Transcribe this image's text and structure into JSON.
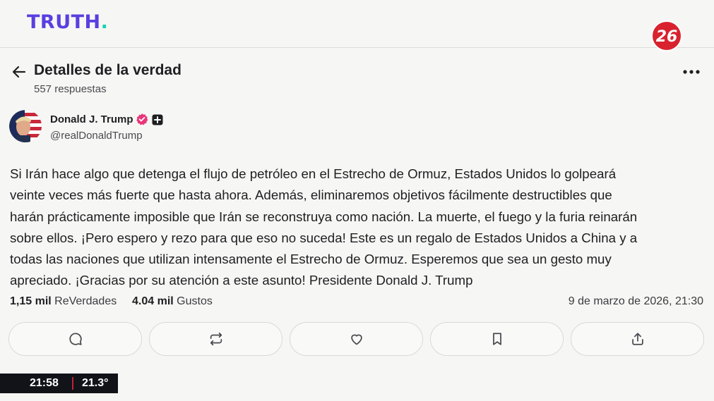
{
  "brand": {
    "logo_text": "TRUTH",
    "logo_dot": ".",
    "accent": "#5a3fe0",
    "dot_color": "#19d3b4"
  },
  "channel": {
    "badge_text": "26",
    "badge_color": "#d8232f"
  },
  "header": {
    "title": "Detalles de la verdad",
    "replies": "557 respuestas",
    "back_icon": "arrow-left-icon",
    "more_icon": "more-horizontal-icon"
  },
  "author": {
    "name": "Donald J. Trump",
    "handle": "@realDonaldTrump",
    "verified_color": "#e8367a"
  },
  "post": {
    "lines": [
      "Si Irán hace algo que detenga el flujo de petróleo en el Estrecho de Ormuz, Estados Unidos lo golpeará",
      "veinte veces más fuerte que hasta ahora. Además, eliminaremos objetivos fácilmente destructibles que",
      "harán prácticamente imposible que Irán se reconstruya como nación. La muerte, el fuego y la furia reinarán",
      "sobre ellos. ¡Pero espero y rezo para que eso no suceda! Este es un regalo de Estados Unidos a China y a",
      "todas las naciones que utilizan intensamente el Estrecho de Ormuz. Esperemos que sea un gesto muy",
      "apreciado. ¡Gracias por su atención a este asunto! Presidente Donald J. Trump"
    ]
  },
  "stats": {
    "retruths_count": "1,15 mil",
    "retruths_label": "ReVerdades",
    "likes_count": "4.04 mil",
    "likes_label": "Gustos",
    "timestamp": "9 de marzo de 2026, 21:30"
  },
  "actions": [
    {
      "icon": "reply-icon"
    },
    {
      "icon": "repost-icon"
    },
    {
      "icon": "heart-icon"
    },
    {
      "icon": "bookmark-icon"
    },
    {
      "icon": "share-icon"
    }
  ],
  "ticker": {
    "time": "21:58",
    "temperature": "21.3°",
    "separator_color": "#c2203a"
  }
}
